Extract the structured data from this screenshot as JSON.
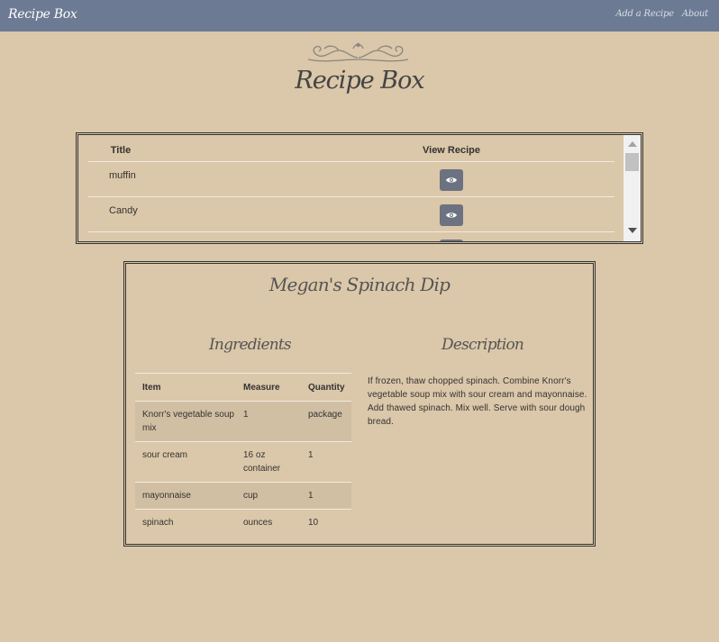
{
  "navbar": {
    "brand": "Recipe Box",
    "links": [
      "Add a Recipe",
      "About"
    ]
  },
  "page": {
    "title": "Recipe Box"
  },
  "recipe_list": {
    "columns": [
      "Title",
      "View Recipe"
    ],
    "rows": [
      {
        "title": "muffin"
      },
      {
        "title": "Candy"
      },
      {
        "title": ""
      }
    ],
    "view_icon": "eye-icon"
  },
  "recipe_detail": {
    "name": "Megan's Spinach Dip",
    "ingredients_heading": "Ingredients",
    "description_heading": "Description",
    "ingredient_columns": [
      "Item",
      "Measure",
      "Quantity"
    ],
    "ingredients": [
      {
        "item": "Knorr's vegetable soup mix",
        "measure": "1",
        "quantity": "package"
      },
      {
        "item": "sour cream",
        "measure": "16 oz container",
        "quantity": "1"
      },
      {
        "item": "mayonnaise",
        "measure": "cup",
        "quantity": "1"
      },
      {
        "item": "spinach",
        "measure": "ounces",
        "quantity": "10"
      }
    ],
    "description": "If frozen, thaw chopped spinach. Combine Knorr's vegetable soup mix with sour cream and mayonnaise. Add thawed spinach. Mix well. Serve with sour dough bread."
  },
  "colors": {
    "background": "#dbc7a9",
    "navbar": "#6c7b93",
    "button": "#6c7280",
    "stripe": "#d1bfa3"
  }
}
